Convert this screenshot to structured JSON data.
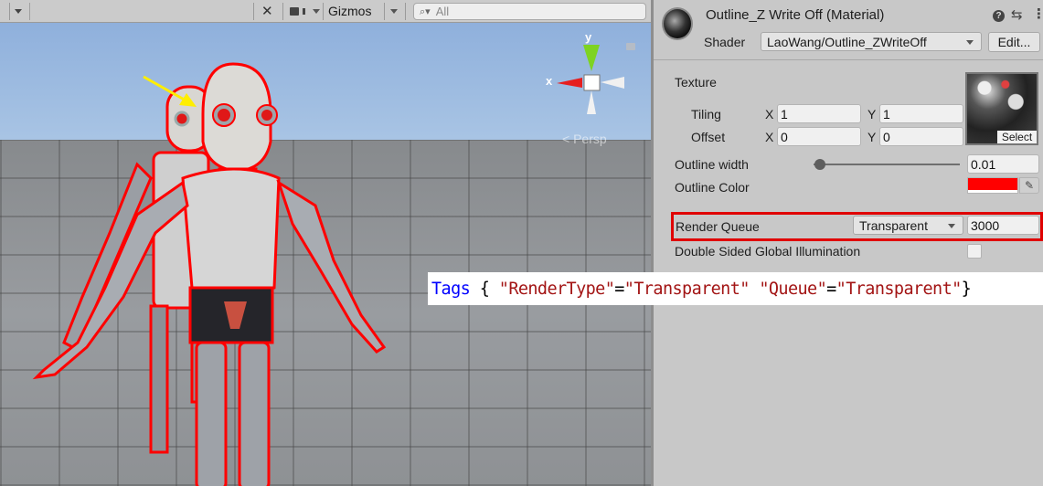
{
  "scene_toolbar": {
    "tools_icon": "wrench-cross-icon",
    "camera_icon": "camera-icon",
    "gizmos_label": "Gizmos",
    "search_placeholder": "All"
  },
  "scene_gizmo": {
    "y_label": "y",
    "x_label": "x",
    "projection_label": "< Persp"
  },
  "inspector": {
    "material_title": "Outline_Z Write Off (Material)",
    "shader_label": "Shader",
    "shader_value": "LaoWang/Outline_ZWriteOff",
    "edit_button": "Edit...",
    "header_icons": [
      "help-icon",
      "preset-sliders-icon",
      "more-menu-icon"
    ],
    "texture": {
      "label": "Texture",
      "select_button": "Select",
      "tiling_label": "Tiling",
      "offset_label": "Offset",
      "x_label": "X",
      "y_label": "Y",
      "tiling_x": "1",
      "tiling_y": "1",
      "offset_x": "0",
      "offset_y": "0"
    },
    "outline_width": {
      "label": "Outline width",
      "value": "0.01",
      "slider_fraction": 0.01
    },
    "outline_color": {
      "label": "Outline Color",
      "color": "#ff0000"
    },
    "render_queue": {
      "label": "Render Queue",
      "mode": "Transparent",
      "value": "3000",
      "highlight_color": "#e00000"
    },
    "double_sided_gi": {
      "label": "Double Sided Global Illumination",
      "checked": false
    }
  },
  "code_overlay": {
    "keyword": "Tags",
    "open_brace": " { ",
    "key1": "\"RenderType\"",
    "eq": "=",
    "val1": "\"Transparent\"",
    "space": " ",
    "key2": "\"Queue\"",
    "val2": "\"Transparent\"",
    "close_brace": "}"
  }
}
